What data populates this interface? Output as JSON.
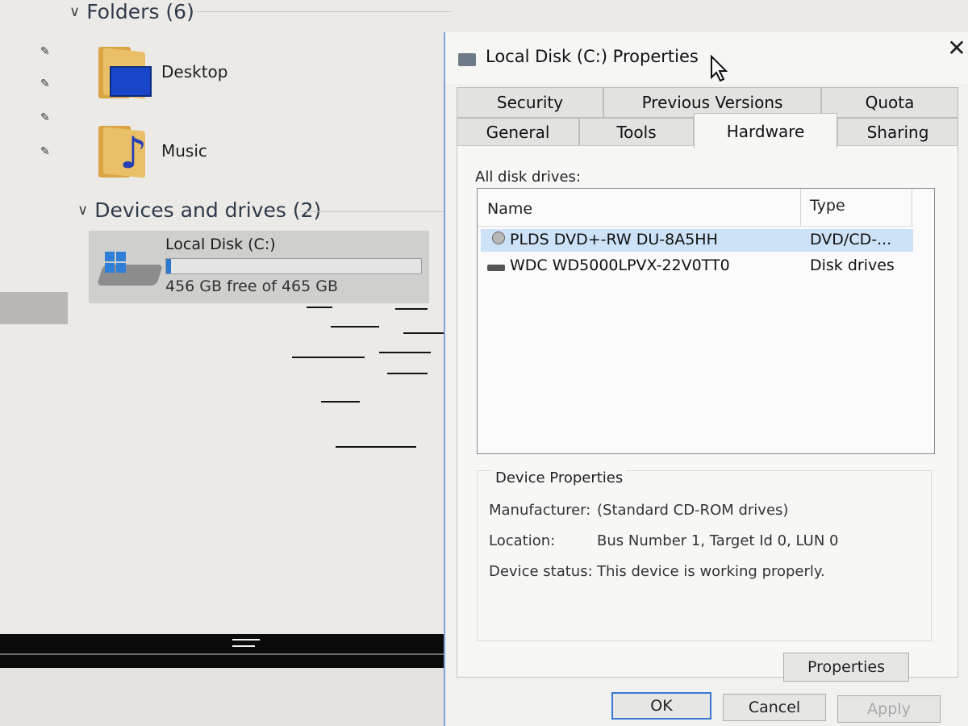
{
  "explorer": {
    "folders_header": "Folders (6)",
    "folders": [
      {
        "label": "Desktop",
        "icon": "desktop-folder-icon"
      },
      {
        "label": "Music",
        "icon": "music-folder-icon"
      }
    ],
    "devices_header": "Devices and drives (2)",
    "drive": {
      "name": "Local Disk (C:)",
      "free_text": "456 GB free of 465 GB",
      "used_fraction": 0.02
    }
  },
  "dialog": {
    "title": "Local Disk (C:) Properties",
    "close_label": "✕",
    "tabs_row1": [
      "Security",
      "Previous Versions",
      "Quota"
    ],
    "tabs_row2": [
      "General",
      "Tools",
      "Hardware",
      "Sharing"
    ],
    "active_tab": "Hardware",
    "all_drives_label": "All disk drives:",
    "columns": {
      "name": "Name",
      "type": "Type"
    },
    "drives": [
      {
        "name": "PLDS DVD+-RW DU-8A5HH",
        "type": "DVD/CD-...",
        "icon": "dvd-drive-icon",
        "selected": true
      },
      {
        "name": "WDC WD5000LPVX-22V0TT0",
        "type": "Disk drives",
        "icon": "hard-disk-icon",
        "selected": false
      }
    ],
    "device_properties": {
      "title": "Device Properties",
      "manufacturer_label": "Manufacturer:",
      "manufacturer": "(Standard CD-ROM drives)",
      "location_label": "Location:",
      "location": "Bus Number 1, Target Id 0, LUN 0",
      "status_label": "Device status:",
      "status": "This device is working properly."
    },
    "buttons": {
      "properties": "Properties",
      "ok": "OK",
      "cancel": "Cancel",
      "apply": "Apply"
    }
  },
  "colors": {
    "accent": "#2b78d0",
    "selection": "#cde2f6"
  }
}
